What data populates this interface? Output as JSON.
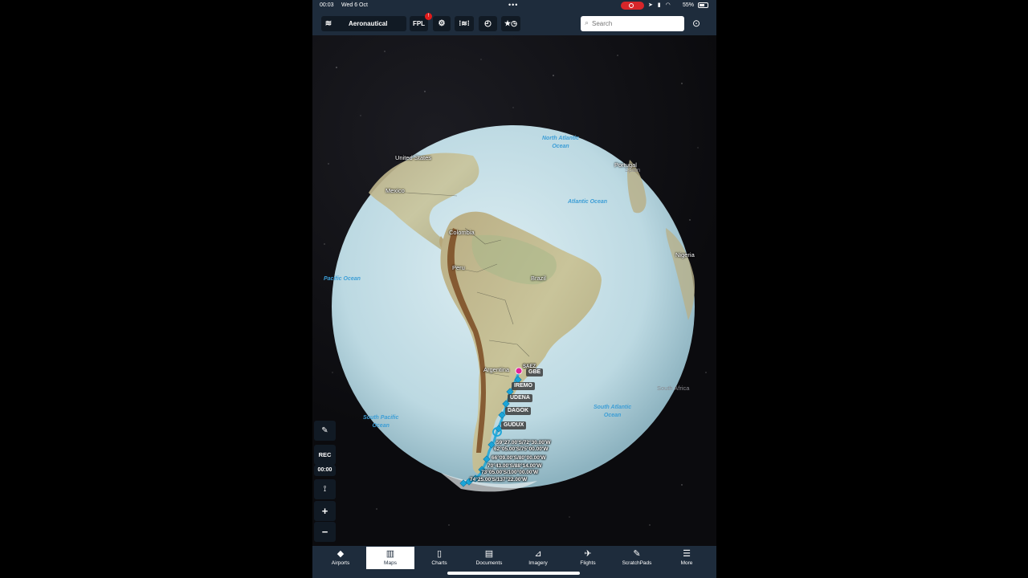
{
  "status_bar": {
    "time": "00:03",
    "date": "Wed 6 Oct",
    "battery": "55%"
  },
  "toolbar": {
    "layers_label": "Aeronautical",
    "fpl_label": "FPL",
    "fpl_badge": "!",
    "search_placeholder": "Search"
  },
  "map": {
    "country_labels": {
      "united_states": "United States",
      "mexico": "Mexico",
      "colombia": "Colombia",
      "peru": "Peru",
      "brazil": "Brazil",
      "argentina": "Argentina",
      "portugal": "Portugal",
      "spain": "Spain",
      "nigeria": "Nigeria",
      "south_africa": "South Africa"
    },
    "ocean_labels": {
      "north_atlantic_1": "North Atlantic",
      "north_atlantic_2": "Ocean",
      "atlantic": "Atlantic Ocean",
      "pacific": "Pacific Ocean",
      "south_pacific_1": "South Pacific",
      "south_pacific_2": "Ocean",
      "south_atlantic_1": "South Atlantic",
      "south_atlantic_2": "Ocean"
    },
    "route_origin": "SAEZ",
    "waypoints": [
      "GBE",
      "IREMO",
      "UDENA",
      "DAGOK",
      "GUDUX"
    ],
    "coordinates": [
      "59°27.00'S/72°30.00'W",
      "62°05.00'S/75°00.00'W",
      "66°09.00'S/80°00.00'W",
      "70°43.00'S/88°14.00'W",
      "73°05.00'S/100°00.00'W",
      "74°25.00'S/137°22.00'W"
    ],
    "colors": {
      "route": "#1aa5d8",
      "ocean_label": "#3d9ed6",
      "origin_marker": "#e0249a"
    }
  },
  "side_controls": {
    "rec_label": "REC",
    "rec_time": "00:00",
    "zoom_in": "+",
    "zoom_out": "−"
  },
  "tabs": [
    {
      "label": "Airports",
      "icon": "airports-icon"
    },
    {
      "label": "Maps",
      "icon": "maps-icon",
      "active": true
    },
    {
      "label": "Charts",
      "icon": "charts-icon"
    },
    {
      "label": "Documents",
      "icon": "documents-icon"
    },
    {
      "label": "Imagery",
      "icon": "imagery-icon"
    },
    {
      "label": "Flights",
      "icon": "flights-icon"
    },
    {
      "label": "ScratchPads",
      "icon": "scratchpads-icon"
    },
    {
      "label": "More",
      "icon": "more-icon"
    }
  ]
}
